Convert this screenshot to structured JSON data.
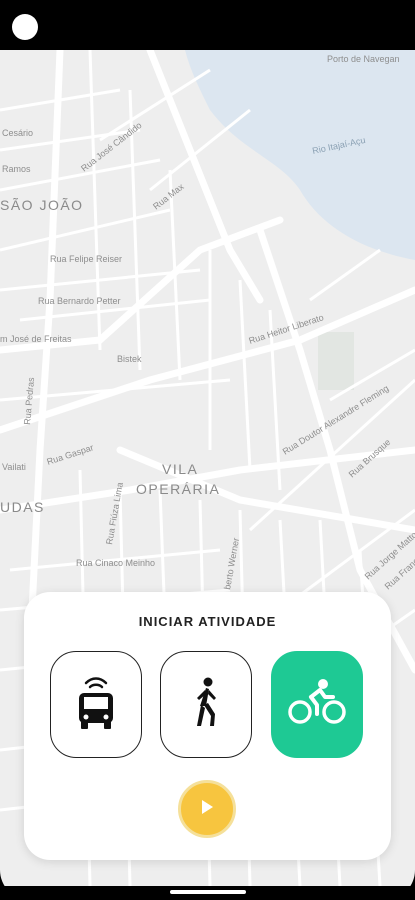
{
  "map": {
    "districts": [
      "SÃO JOÃO",
      "VILA",
      "OPERÁRIA",
      "UDAS"
    ],
    "water": "Rio Itajaí-Açu",
    "streets": [
      "Porto de Navegan",
      "Rua José Cândido",
      "Cesário",
      "Ramos",
      "Rua Max",
      "Rua Felipe Reiser",
      "Rua Bernardo Petter",
      "m José de Freitas",
      "Bistek",
      "Rua Heitor Liberato",
      "Rua Doutor Alexandre Fleming",
      "Rua Brusque",
      "Rua Gaspar",
      "Rua Fiúza Lima",
      "Rua Cinaco Meinho",
      "Rua Jorge Mattos",
      "Vailati",
      "berto Werner",
      "Rua Pedras",
      "Rua Francisco"
    ]
  },
  "panel": {
    "title": "INICIAR ATIVIDADE",
    "modes": [
      {
        "name": "bus",
        "icon": "bus-icon",
        "active": false
      },
      {
        "name": "walk",
        "icon": "walking-icon",
        "active": false
      },
      {
        "name": "bike",
        "icon": "bicycle-icon",
        "active": true
      }
    ],
    "play_icon": "play-icon"
  },
  "colors": {
    "active_mode": "#1ec994",
    "play": "#f7c53f",
    "map_background": "#eeeeee",
    "water": "#dce6f0"
  }
}
